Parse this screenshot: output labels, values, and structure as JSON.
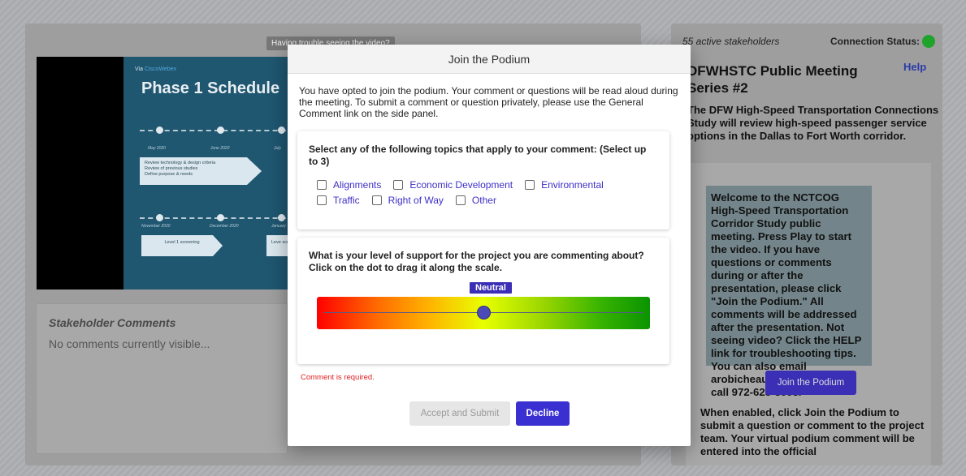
{
  "video": {
    "trouble_text": "Having trouble seeing the video?",
    "slide": {
      "brand_prefix": "Via ",
      "brand_name": "CiscoWebex",
      "title": "Phase 1 Schedule",
      "row1_dates": [
        "May 2020",
        "June 2020",
        "July"
      ],
      "row1_box": "Review technology & design criteria\nReview of previous studies\nDefine purpose & needs",
      "row2_dates": [
        "November 2020",
        "December 2020",
        "January"
      ],
      "row2_box1": "Level 1 screening",
      "row2_box2": "Leve scree"
    }
  },
  "comments": {
    "title": "Stakeholder Comments",
    "empty_text": "No comments currently visible..."
  },
  "side": {
    "stakeholders": "55 active stakeholders",
    "connection_label": "Connection Status:",
    "connection_color": "#1fa32b",
    "meeting_title": "DFWHSTC Public Meeting Series #2",
    "help_label": "Help",
    "description": "The DFW High-Speed Transportation Connections Study will review high-speed passenger service options in the Dallas to Fort Worth corridor.",
    "welcome": "Welcome to the NCTCOG High-Speed Transportation Corridor Study public meeting. Press Play to start the video. If you have questions or comments during or after the presentation, please click \"Join the Podium.\" All comments will be addressed after the presentation. Not seeing video? Click the HELP link for troubleshooting tips. You can also email arobicheaux@hntb.com or call 972-628-3003.",
    "join_button": "Join the Podium",
    "note": "When enabled, click Join the Podium to submit a question or comment to the project team. Your virtual podium comment will be entered into the official"
  },
  "modal": {
    "title": "Join the Podium",
    "intro": "You have opted to join the podium. Your comment or questions will be read aloud during the meeting. To submit a comment or question privately, please use the General Comment link on the side panel.",
    "topics_question": "Select any of the following topics that apply to your comment: (Select up to 3)",
    "topics": [
      "Alignments",
      "Economic Development",
      "Environmental",
      "Traffic",
      "Right of Way",
      "Other"
    ],
    "support_question": "What is your level of support for the project you are commenting about? Click on the dot to drag it along the scale.",
    "support_level_label": "Neutral",
    "support_level_value": 0.5,
    "error": "Comment is required.",
    "accept_label": "Accept and Submit",
    "decline_label": "Decline",
    "accent_color": "#3a2fd0"
  }
}
